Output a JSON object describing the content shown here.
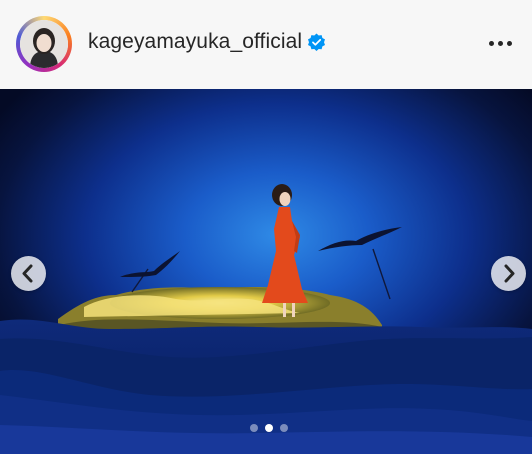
{
  "post": {
    "username": "kageyamayuka_official",
    "verified": true,
    "avatar": "profile-photo",
    "more_icon": "more-horizontal-icon",
    "verified_icon": "verified-badge-icon",
    "ring_colors": [
      "#feda75",
      "#fa7e1e",
      "#d62976",
      "#962fbf",
      "#4f5bd5"
    ]
  },
  "carousel": {
    "current_slide": 2,
    "total_slides": 3,
    "prev_icon": "chevron-left-icon",
    "next_icon": "chevron-right-icon",
    "image": "woman-in-orange-dress-on-glowing-island-with-birds"
  },
  "colors": {
    "text": "#262626",
    "verified": "#0095f6",
    "header_bg": "#f7f7f7"
  }
}
